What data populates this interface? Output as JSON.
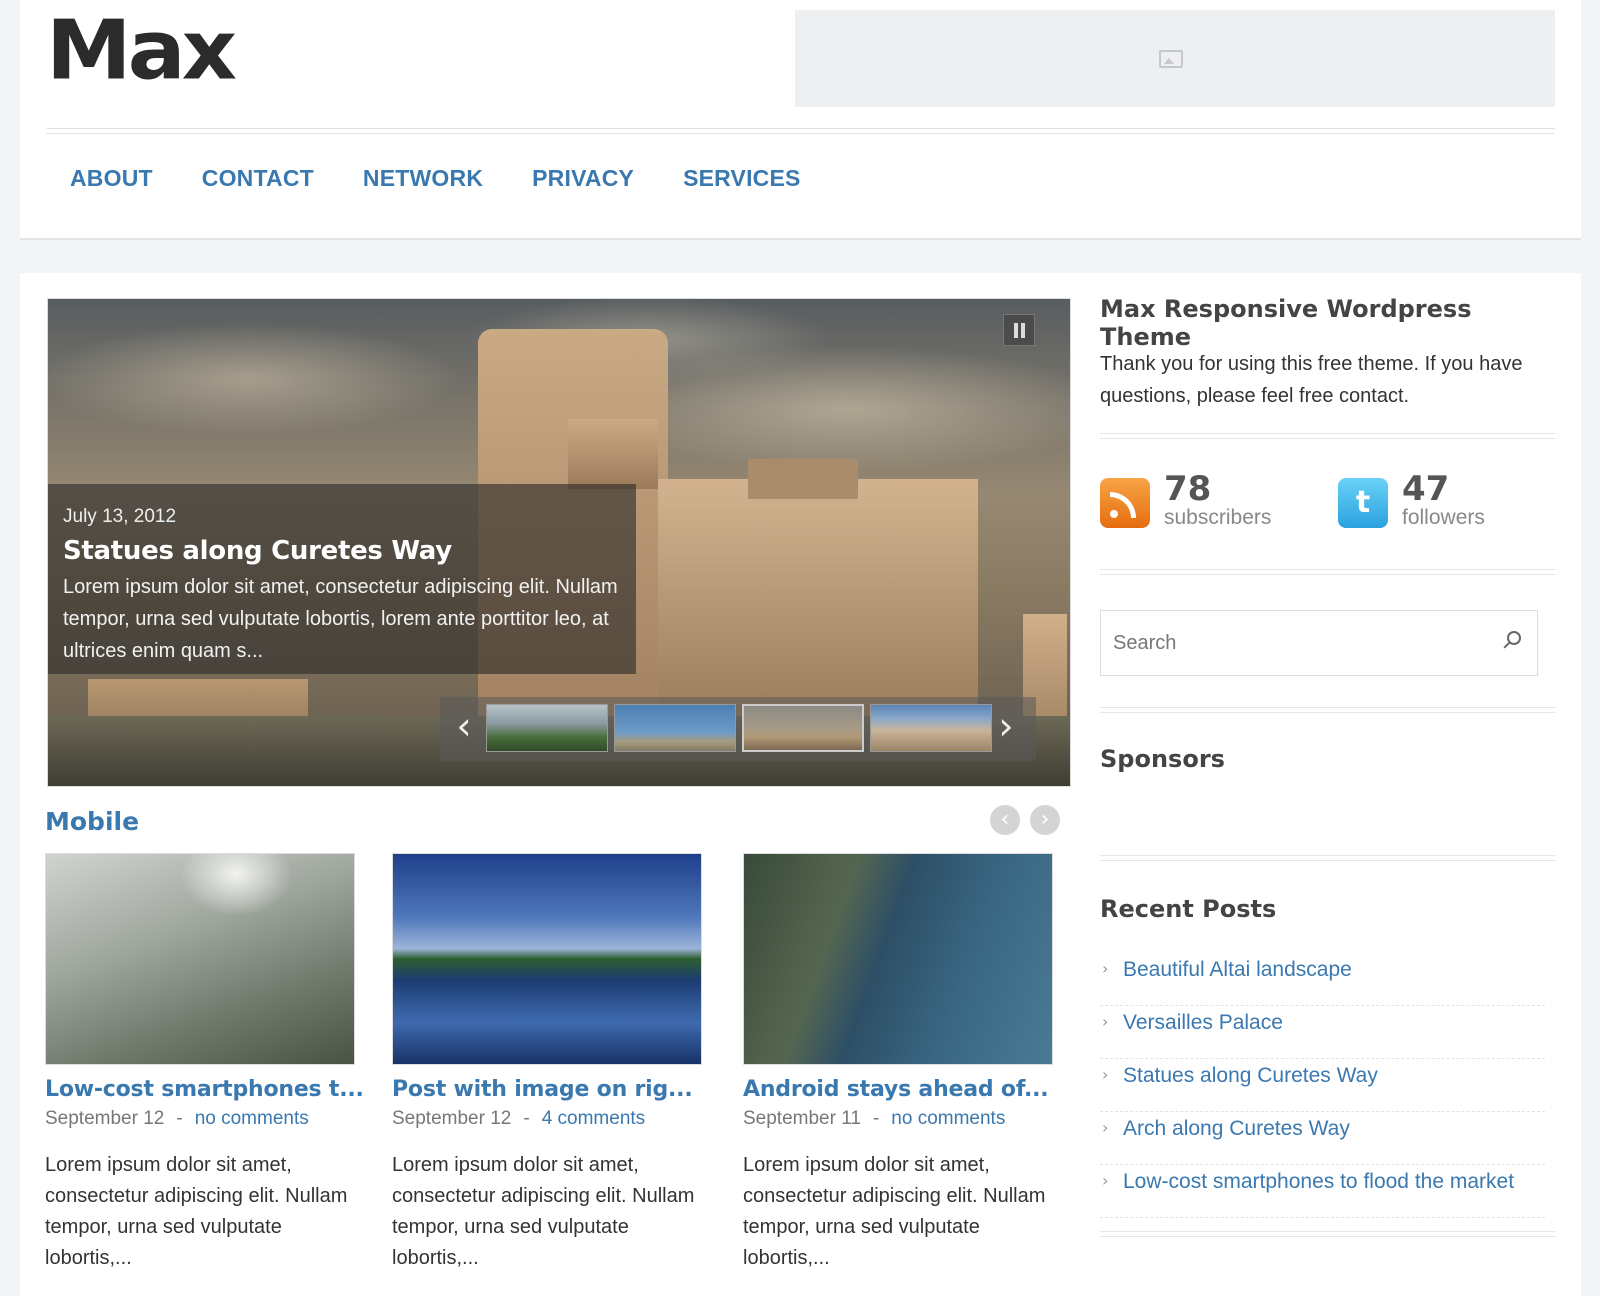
{
  "header": {
    "logo": "Max",
    "nav": [
      "ABOUT",
      "CONTACT",
      "NETWORK",
      "PRIVACY",
      "SERVICES"
    ]
  },
  "slider": {
    "date": "July 13, 2012",
    "title": "Statues along Curetes Way",
    "excerpt": "Lorem ipsum dolor sit amet, consectetur adipiscing elit. Nullam tempor, urna sed vulputate lobortis, lorem ante porttitor leo, at ultrices enim quam s...",
    "prev": "‹",
    "next": "›"
  },
  "mobile": {
    "title": "Mobile",
    "prev": "‹",
    "next": "›",
    "posts": [
      {
        "title": "Low-cost smartphones t...",
        "date": "September 12",
        "comments": "no comments",
        "excerpt": "Lorem ipsum dolor sit amet, consectetur adipiscing elit. Nullam tempor, urna sed vulputate lobortis,..."
      },
      {
        "title": "Post with image on rig...",
        "date": "September 12",
        "comments": "4 comments",
        "excerpt": "Lorem ipsum dolor sit amet, consectetur adipiscing elit. Nullam tempor, urna sed vulputate lobortis,..."
      },
      {
        "title": "Android stays ahead of...",
        "date": "September 11",
        "comments": "no comments",
        "excerpt": "Lorem ipsum dolor sit amet, consectetur adipiscing elit. Nullam tempor, urna sed vulputate lobortis,..."
      }
    ],
    "meta_sep": "-"
  },
  "sidebar": {
    "about_title": "Max Responsive Wordpress Theme",
    "about_text": "Thank you for using this free theme. If you have questions, please feel free contact.",
    "rss_count": "78",
    "rss_label": "subscribers",
    "twitter_count": "47",
    "twitter_label": "followers",
    "search_placeholder": "Search",
    "sponsors_title": "Sponsors",
    "recent_title": "Recent Posts",
    "recent": [
      "Beautiful Altai landscape",
      "Versailles Palace",
      "Statues along Curetes Way",
      "Arch along Curetes Way",
      "Low-cost smartphones to flood the market"
    ],
    "chev": "›"
  },
  "colors": {
    "link": "#3a78b0",
    "rss": "#f08a28",
    "twitter": "#3fb5ea"
  }
}
